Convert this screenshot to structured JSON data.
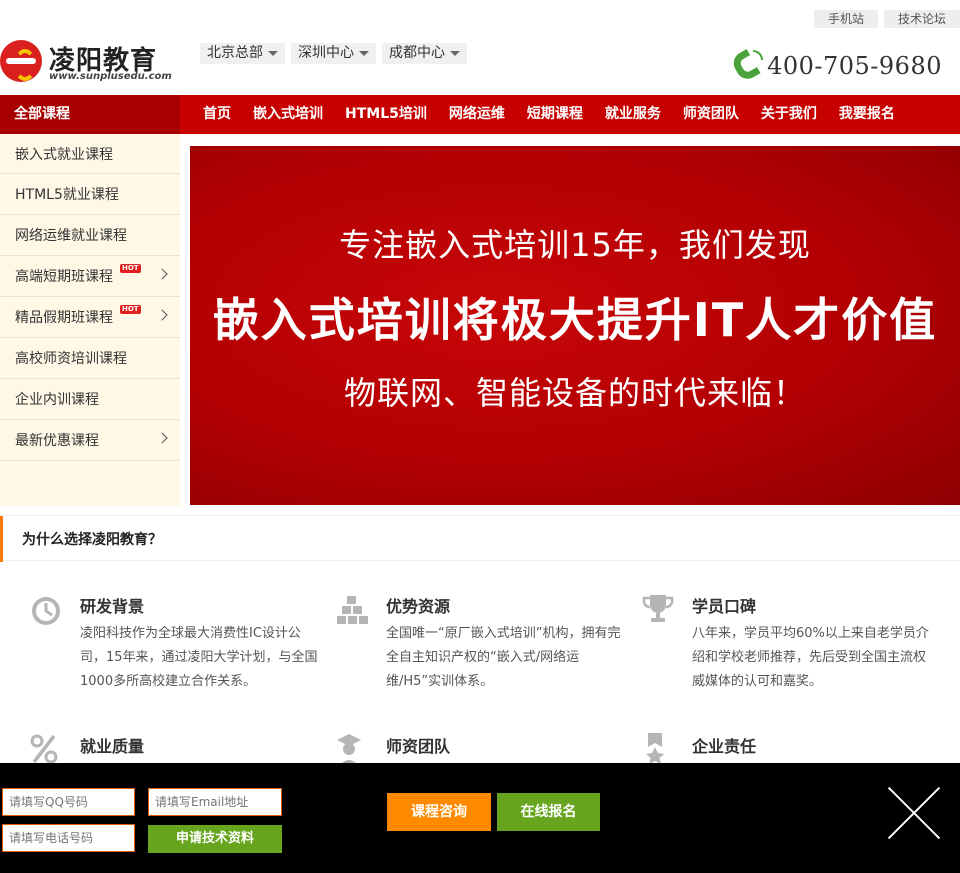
{
  "toplinks": {
    "mobile": "手机站",
    "forum": "技术论坛"
  },
  "logo": {
    "name": "凌阳教育",
    "url": "www.sunplusedu.com"
  },
  "branches": [
    "北京总部",
    "深圳中心",
    "成都中心"
  ],
  "phone": "400-705-9680",
  "nav": {
    "all_courses": "全部课程",
    "items": [
      "首页",
      "嵌入式培训",
      "HTML5培训",
      "网络运维",
      "短期课程",
      "就业服务",
      "师资团队",
      "关于我们",
      "我要报名"
    ]
  },
  "sidebar": {
    "items": [
      {
        "label": "嵌入式就业课程"
      },
      {
        "label": "HTML5就业课程"
      },
      {
        "label": "网络运维就业课程"
      },
      {
        "label": "高端短期班课程",
        "badge": "HOT"
      },
      {
        "label": "精品假期班课程",
        "badge": "HOT"
      },
      {
        "label": "高校师资培训课程"
      },
      {
        "label": "企业内训课程"
      },
      {
        "label": "最新优惠课程"
      }
    ]
  },
  "banner": {
    "line1": "专注嵌入式培训15年，我们发现",
    "line2": "嵌入式培训将极大提升IT人才价值",
    "line3": "物联网、智能设备的时代来临！"
  },
  "why": {
    "title": "为什么选择凌阳教育？",
    "features": [
      {
        "icon": "clock-icon",
        "title": "研发背景",
        "desc": "凌阳科技作为全球最大消费性IC设计公司，15年来，通过凌阳大学计划，与全国1000多所高校建立合作关系。"
      },
      {
        "icon": "blocks-icon",
        "title": "优势资源",
        "desc": "全国唯一“原厂嵌入式培训”机构，拥有完全自主知识产权的“嵌入式/网络运维/H5”实训体系。"
      },
      {
        "icon": "trophy-icon",
        "title": "学员口碑",
        "desc": "八年来，学员平均60%以上来自老学员介绍和学校老师推荐，先后受到全国主流权威媒体的认可和嘉奖。"
      },
      {
        "icon": "percent-icon",
        "title": "就业质量",
        "desc": ""
      },
      {
        "icon": "graduate-icon",
        "title": "师资团队",
        "desc": ""
      },
      {
        "icon": "award-icon",
        "title": "企业责任",
        "desc": ""
      }
    ]
  },
  "bottombar": {
    "qq_placeholder": "请填写QQ号码",
    "email_placeholder": "请填写Email地址",
    "phone_placeholder": "请填写电话号码",
    "apply_btn": "申请技术资料",
    "consult_btn": "课程咨询",
    "signup_btn": "在线报名"
  },
  "colors": {
    "brand_red": "#c70000",
    "dark_red": "#a80000",
    "orange": "#ff8a00",
    "green": "#67a51e",
    "sidebar_bg": "#fff8e6"
  }
}
